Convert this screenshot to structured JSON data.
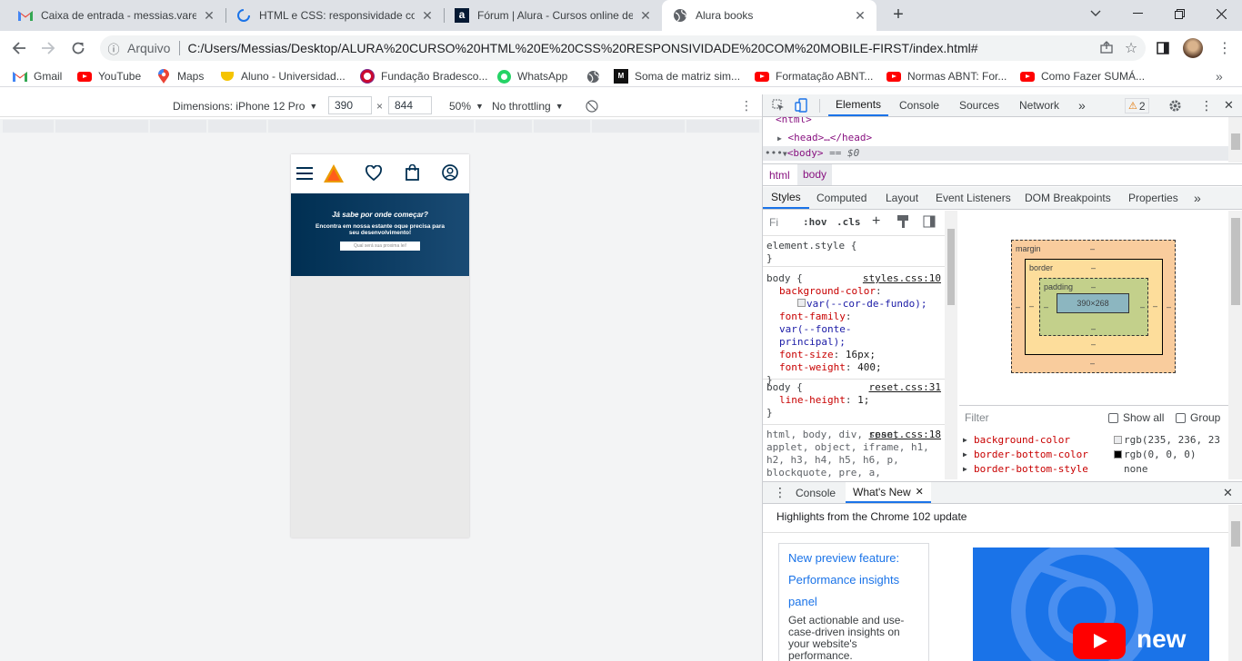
{
  "browser": {
    "tabs": [
      {
        "title": "Caixa de entrada - messias.varelo",
        "icon": "gmail-icon"
      },
      {
        "title": "HTML e CSS: responsividade com",
        "icon": "loading-spinner-icon"
      },
      {
        "title": "Fórum | Alura - Cursos online de",
        "icon": "alura-icon"
      },
      {
        "title": "Alura books",
        "icon": "globe-icon"
      }
    ],
    "address": {
      "scheme_label": "Arquivo",
      "url": "C:/Users/Messias/Desktop/ALURA%20CURSO%20HTML%20E%20CSS%20RESPONSIVIDADE%20COM%20MOBILE-FIRST/index.html#"
    },
    "bookmarks": [
      {
        "label": "Gmail",
        "icon": "gmail-icon"
      },
      {
        "label": "YouTube",
        "icon": "youtube-icon"
      },
      {
        "label": "Maps",
        "icon": "maps-pin-icon"
      },
      {
        "label": "Aluno - Universidad...",
        "icon": "university-icon"
      },
      {
        "label": "Fundação Bradesco...",
        "icon": "bradesco-icon"
      },
      {
        "label": "WhatsApp",
        "icon": "whatsapp-icon"
      },
      {
        "label": "",
        "icon": "globe-icon"
      },
      {
        "label": "Soma de matriz sim...",
        "icon": "matrix-icon"
      },
      {
        "label": "Formatação ABNT...",
        "icon": "youtube-icon"
      },
      {
        "label": "Normas ABNT: For...",
        "icon": "youtube-icon"
      },
      {
        "label": "Como Fazer SUMÁ...",
        "icon": "youtube-icon"
      }
    ]
  },
  "device_toolbar": {
    "dimensions_label": "Dimensions: iPhone 12 Pro",
    "width": "390",
    "height": "844",
    "zoom": "50%",
    "throttling": "No throttling"
  },
  "page": {
    "banner_heading": "Já sabe por onde começar?",
    "banner_text": "Encontra em nossa estante oque precisa para seu desenvolvimento!",
    "search_placeholder": "Qual será sua proxima lei!"
  },
  "devtools": {
    "tabs": [
      "Elements",
      "Console",
      "Sources",
      "Network"
    ],
    "warning_count": "2",
    "dom": {
      "html_tag": "<html>",
      "head_tag": "<head>…</head>",
      "body_tag": "<body>",
      "body_eq": "== $0"
    },
    "breadcrumbs": [
      "html",
      "body"
    ],
    "sub_tabs": [
      "Styles",
      "Computed",
      "Layout",
      "Event Listeners",
      "DOM Breakpoints",
      "Properties"
    ],
    "filter_placeholder": "Fi",
    "hov": ":hov",
    "cls": ".cls",
    "rules": {
      "element_style": "element.style {",
      "close": "}",
      "body1_selector": "body {",
      "body1_source": "styles.css:10",
      "body1_props": [
        {
          "name": "background-color",
          "value": "var(--cor-de-fundo);"
        },
        {
          "name": "font-family",
          "value": "var(--fonte-principal);"
        },
        {
          "name": "font-size",
          "value": "16px;"
        },
        {
          "name": "font-weight",
          "value": "400;"
        }
      ],
      "body2_selector": "body {",
      "body2_source": "reset.css:31",
      "body2_prop": {
        "name": "line-height",
        "value": "1;"
      },
      "reset_selector": "html, body, div, span, applet, object, iframe, h1, h2, h3, h4, h5, h6, p, blockquote, pre, a,",
      "reset_source": "reset.css:18"
    },
    "box_model": {
      "margin_label": "margin",
      "border_label": "border",
      "padding_label": "padding",
      "dash": "–",
      "content": "390×268"
    },
    "computed": {
      "filter_placeholder": "Filter",
      "show_all": "Show all",
      "group": "Group",
      "props": [
        {
          "name": "background-color",
          "value": "rgb(235, 236, 23",
          "swatch": "#ebecee"
        },
        {
          "name": "border-bottom-color",
          "value": "rgb(0, 0, 0)",
          "swatch": "#000000"
        },
        {
          "name": "border-bottom-style",
          "value": "none",
          "swatch": ""
        }
      ]
    },
    "drawer": {
      "tabs": [
        "Console",
        "What's New"
      ],
      "headline": "Highlights from the Chrome 102 update",
      "card_link": "New preview feature: Performance insights panel",
      "card_text": "Get actionable and use-case-driven insights on your website's performance.",
      "video_badge": "new"
    }
  }
}
